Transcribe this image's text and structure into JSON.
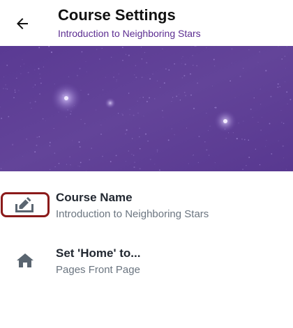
{
  "header": {
    "back_icon": "arrow-left-icon",
    "title": "Course Settings",
    "subtitle": "Introduction to Neighboring Stars"
  },
  "banner": {
    "image": "course-banner-image",
    "color": "#5c3d96"
  },
  "settings": [
    {
      "icon": "edit-pencil-icon",
      "title": "Course Name",
      "value": "Introduction to Neighboring Stars"
    },
    {
      "icon": "home-icon",
      "title": "Set 'Home' to...",
      "value": "Pages Front Page"
    }
  ],
  "colors": {
    "accent": "#5c2d91",
    "highlight_border": "#8b1a1a",
    "icon_gray": "#5a6570"
  }
}
